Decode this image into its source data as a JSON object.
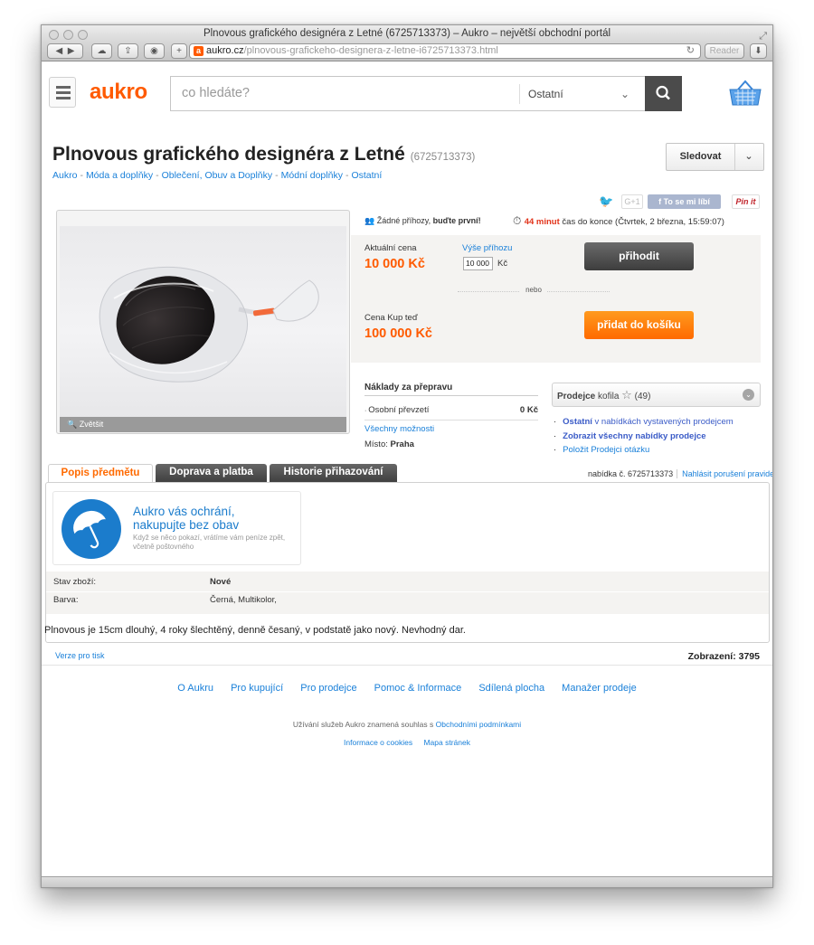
{
  "window": {
    "title": "Plnovous grafického designéra z Letné (6725713373) – Aukro – největší obchodní portál",
    "url_host": "aukro.cz",
    "url_path": "/plnovous-grafickeho-designera-z-letne-i6725713373.html",
    "reader": "Reader"
  },
  "header": {
    "logo": "aukro",
    "search_placeholder": "co hledáte?",
    "category": "Ostatní"
  },
  "item": {
    "title": "Plnovous grafického designéra z Letné",
    "id": "(6725713373)",
    "follow_label": "Sledovat",
    "breadcrumbs": [
      "Aukro",
      "Móda a doplňky",
      "Oblečení, Obuv a Doplňky",
      "Módní doplňky",
      "Ostatní"
    ],
    "zoom_label": "Zvětšit",
    "social": {
      "gplus": "G+1",
      "like": "To se mi líbí",
      "pinit": "Pin it"
    }
  },
  "bidding": {
    "no_bids": "Žádné příhozy,",
    "be_first": "buďte první!",
    "time_left": "44 minut",
    "time_suffix": "čas do konce (Čtvrtek, 2 března, 15:59:07)",
    "current_price_label": "Aktuální cena",
    "current_price": "10 000 Kč",
    "bid_amount_label": "Výše příhozu",
    "bid_input_value": "10 000",
    "currency": "Kč",
    "bid_button": "přihodit",
    "or": "nebo",
    "buy_now_label": "Cena Kup teď",
    "buy_now_price": "100 000 Kč",
    "add_to_cart": "přidat do košíku"
  },
  "shipping": {
    "heading": "Náklady za přepravu",
    "method": "Osobní převzetí",
    "method_price": "0 Kč",
    "all_options": "Všechny možnosti",
    "place_label": "Místo:",
    "place": "Praha"
  },
  "seller": {
    "label": "Prodejce",
    "name": "kofila",
    "rating": "(49)",
    "links": {
      "other_a": "Ostatní",
      "other_b": " v nabídkách vystavených prodejcem",
      "all_offers": "Zobrazit všechny nabídky prodejce",
      "ask": "Položit Prodejci otázku"
    }
  },
  "tabs": [
    "Popis předmětu",
    "Doprava a platba",
    "Historie přihazování"
  ],
  "offer": {
    "number_label": "nabídka č. 6725713373",
    "report": "Nahlásit porušení pravidel"
  },
  "protection": {
    "line1": "Aukro vás ochrání,",
    "line2": "nakupujte bez obav",
    "small1": "Když se něco pokazí, vrátíme vám peníze zpět,",
    "small2": "včetně poštovného"
  },
  "params": [
    {
      "label": "Stav zboží:",
      "value": "Nové"
    },
    {
      "label": "Barva:",
      "value": "Černá, Multikolor,"
    }
  ],
  "description": "Plnovous je 15cm dlouhý, 4 roky šlechtěný, denně česaný, v podstatě jako nový. Nevhodný dar.",
  "print_label": "Verze pro tisk",
  "views": "Zobrazení: 3795",
  "footer": {
    "nav": [
      "O Aukru",
      "Pro kupující",
      "Pro prodejce",
      "Pomoc & Informace",
      "Sdílená plocha",
      "Manažer prodeje"
    ],
    "legal_text": "Užívání služeb Aukro znamená souhlas s",
    "legal_link": "Obchodními podmínkami",
    "cookies": "Informace o cookies",
    "sitemap": "Mapa stránek"
  },
  "colors": {
    "brand": "#ff5a00",
    "link": "#1a80d9",
    "price": "#ff5a00",
    "timer": "#e2331a"
  }
}
